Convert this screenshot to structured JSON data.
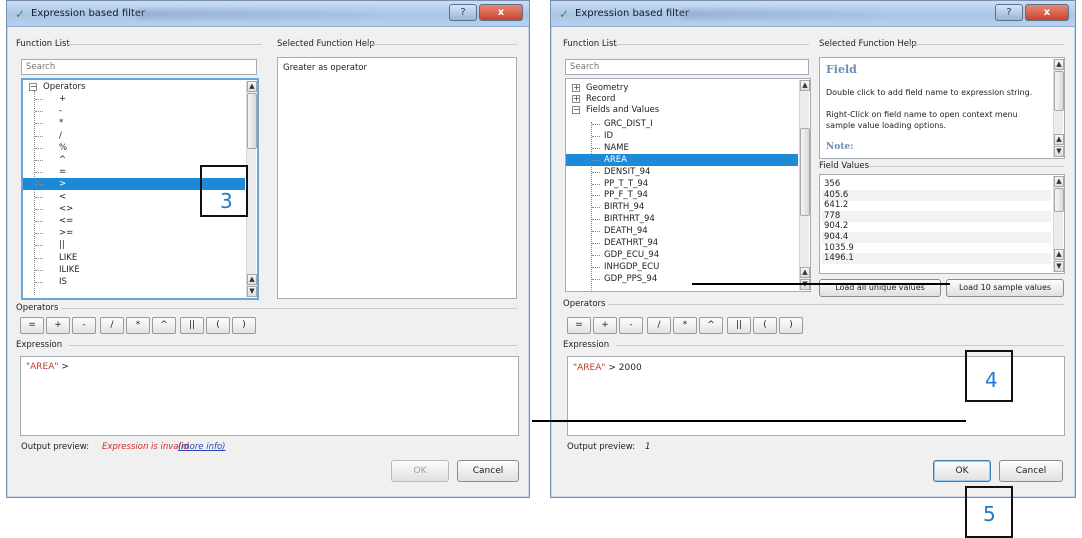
{
  "left_dialog": {
    "title": "Expression based filter",
    "help_button": "?",
    "close_button": "x",
    "function_list_label": "Function List",
    "search_placeholder": "Search",
    "tree_root": "Operators",
    "operators": [
      "+",
      "-",
      "*",
      "/",
      "%",
      "^",
      "=",
      ">",
      "<",
      "<>",
      "<=",
      ">=",
      "||",
      "LIKE",
      "ILIKE",
      "IS"
    ],
    "selected_operator": ">",
    "help_label": "Selected Function Help",
    "help_text": "Greater as operator",
    "operators_label": "Operators",
    "operator_buttons": [
      "=",
      "+",
      "-",
      "/",
      "*",
      "^",
      "||",
      "(",
      ")"
    ],
    "expression_label": "Expression",
    "expression_field": "\"AREA\"",
    "expression_rest": " >",
    "output_label": "Output preview:",
    "output_value": "Expression is invalid",
    "more_info": "(more info)",
    "ok": "OK",
    "cancel": "Cancel"
  },
  "right_dialog": {
    "title": "Expression based filter",
    "help_button": "?",
    "close_button": "x",
    "function_list_label": "Function List",
    "search_placeholder": "Search",
    "groups": [
      "Geometry",
      "Record",
      "Fields and Values"
    ],
    "fields": [
      "GRC_DIST_I",
      "ID",
      "NAME",
      "AREA",
      "DENSIT_94",
      "PP_T_T_94",
      "PP_F_T_94",
      "BIRTH_94",
      "BIRTHRT_94",
      "DEATH_94",
      "DEATHRT_94",
      "GDP_ECU_94",
      "INHGDP_ECU",
      "GDP_PPS_94"
    ],
    "selected_field": "AREA",
    "help_label": "Selected Function Help",
    "help_title": "Field",
    "help_p1": "Double click to add field name to expression string.",
    "help_p2": "Right-Click on field name to open context menu sample value loading options.",
    "help_note": "Note:",
    "field_values_label": "Field Values",
    "field_values": [
      "356",
      "405.6",
      "641.2",
      "778",
      "904.2",
      "904.4",
      "1035.9",
      "1496.1"
    ],
    "load_all": "Load all unique values",
    "load_sample": "Load 10 sample values",
    "operators_label": "Operators",
    "operator_buttons": [
      "=",
      "+",
      "-",
      "/",
      "*",
      "^",
      "||",
      "(",
      ")"
    ],
    "expression_label": "Expression",
    "expression_field": "\"AREA\"",
    "expression_rest": " > 2000",
    "output_label": "Output preview:",
    "output_value": "1",
    "ok": "OK",
    "cancel": "Cancel"
  },
  "callouts": [
    "3",
    "4",
    "5"
  ]
}
